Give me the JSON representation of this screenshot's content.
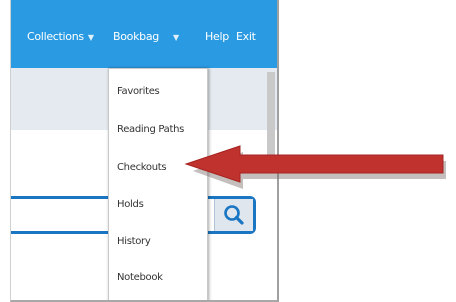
{
  "nav": {
    "collections": "Collections",
    "bookbag": "Bookbag",
    "help": "Help",
    "exit": "Exit"
  },
  "menu": {
    "items": [
      "Favorites",
      "Reading Paths",
      "Checkouts",
      "Holds",
      "History",
      "Notebook"
    ]
  },
  "colors": {
    "topbar": "#2a9be2",
    "search_border": "#1a75c2",
    "arrow": "#c0322e"
  },
  "icons": {
    "search": "search-icon",
    "caret": "chevron-down-icon",
    "annotation": "arrow-left-icon"
  }
}
